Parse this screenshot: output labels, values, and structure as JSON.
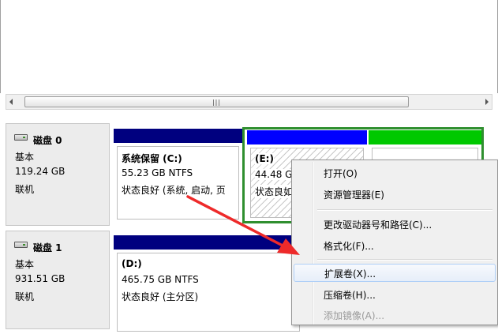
{
  "disk0": {
    "name": "磁盘 0",
    "type": "基本",
    "size": "119.24 GB",
    "status": "联机",
    "partitions": [
      {
        "name": "系统保留  (C:)",
        "size": "55.23 GB NTFS",
        "status": "状态良好 (系统, 启动, 页"
      },
      {
        "name": "(E:)",
        "size": "44.48 G",
        "status": "状态良如"
      },
      {
        "name": "",
        "size": "",
        "status": ""
      }
    ]
  },
  "disk1": {
    "name": "磁盘 1",
    "type": "基本",
    "size": "931.51 GB",
    "status": "联机",
    "partitions": [
      {
        "name": "(D:)",
        "size": "465.75 GB NTFS",
        "status": "状态良好 (主分区)"
      }
    ]
  },
  "context_menu": {
    "items": [
      {
        "label": "打开(O)",
        "enabled": true
      },
      {
        "label": "资源管理器(E)",
        "enabled": true
      },
      {
        "label": "更改驱动器号和路径(C)...",
        "enabled": true
      },
      {
        "label": "格式化(F)...",
        "enabled": true
      },
      {
        "label": "扩展卷(X)...",
        "enabled": true,
        "highlighted": true
      },
      {
        "label": "压缩卷(H)...",
        "enabled": true
      },
      {
        "label": "添加镜像(A)...",
        "enabled": false
      }
    ]
  },
  "colors": {
    "primary_partition_bar": "#00007f",
    "logical_partition_bar": "#0000ff",
    "free_space_bar": "#00c800",
    "selection_outline": "#2f8f2f",
    "annotation_arrow": "#ee2a2a"
  },
  "icons": {
    "disk": "hard-disk-icon",
    "scroll_left": "arrow-left-icon",
    "scroll_right": "arrow-right-icon"
  }
}
